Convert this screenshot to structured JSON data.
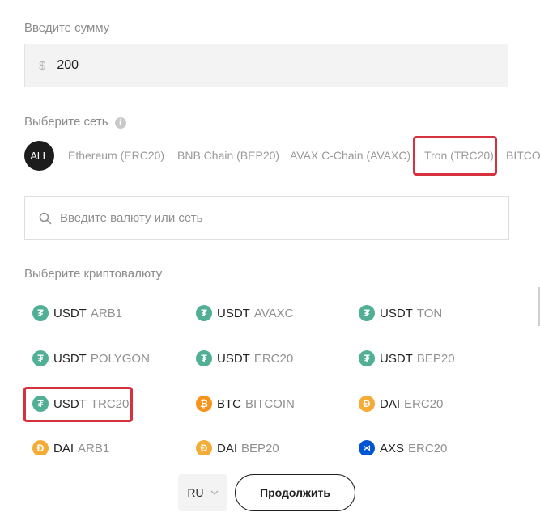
{
  "amount": {
    "label": "Введите сумму",
    "currency_symbol": "$",
    "value": "200"
  },
  "network": {
    "label": "Выберите сеть",
    "chips": [
      {
        "label": "ALL",
        "active": true
      },
      {
        "label": "Ethereum (ERC20)",
        "active": false
      },
      {
        "label": "BNB Chain (BEP20)",
        "active": false
      },
      {
        "label": "AVAX C-Chain (AVAXC)",
        "active": false
      },
      {
        "label": "Tron (TRC20)",
        "active": false,
        "highlighted": true
      },
      {
        "label": "BITCOIN",
        "active": false
      }
    ]
  },
  "search": {
    "placeholder": "Введите валюту или сеть"
  },
  "crypto": {
    "label": "Выберите криптовалюту",
    "items": [
      {
        "symbol": "USDT",
        "network": "ARB1",
        "icon": "tether-icon"
      },
      {
        "symbol": "USDT",
        "network": "AVAXC",
        "icon": "tether-icon"
      },
      {
        "symbol": "USDT",
        "network": "TON",
        "icon": "tether-icon"
      },
      {
        "symbol": "USDT",
        "network": "POLYGON",
        "icon": "tether-icon"
      },
      {
        "symbol": "USDT",
        "network": "ERC20",
        "icon": "tether-icon"
      },
      {
        "symbol": "USDT",
        "network": "BEP20",
        "icon": "tether-icon"
      },
      {
        "symbol": "USDT",
        "network": "TRC20",
        "icon": "tether-icon",
        "highlighted": true
      },
      {
        "symbol": "BTC",
        "network": "BITCOIN",
        "icon": "bitcoin-icon"
      },
      {
        "symbol": "DAI",
        "network": "ERC20",
        "icon": "dai-icon"
      },
      {
        "symbol": "DAI",
        "network": "ARB1",
        "icon": "dai-icon"
      },
      {
        "symbol": "DAI",
        "network": "BEP20",
        "icon": "dai-icon"
      },
      {
        "symbol": "AXS",
        "network": "ERC20",
        "icon": "axs-icon"
      }
    ]
  },
  "footer": {
    "language": "RU",
    "continue_label": "Продолжить"
  },
  "colors": {
    "tether": "#50af95",
    "bitcoin": "#f7931a",
    "dai": "#f5ac37",
    "axs": "#0055d5",
    "highlight": "#d6313f"
  }
}
